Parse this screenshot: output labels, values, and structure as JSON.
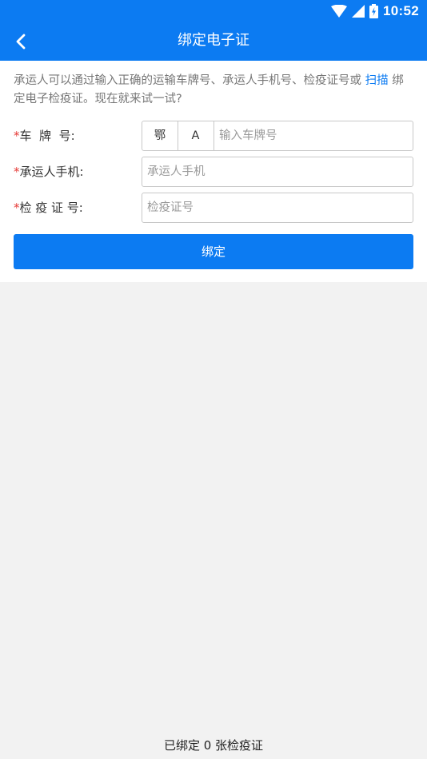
{
  "status_bar": {
    "time": "10:52"
  },
  "app_bar": {
    "title": "绑定电子证"
  },
  "intro": {
    "text_before": "承运人可以通过输入正确的运输车牌号、承运人手机号、检疫证号或 ",
    "link": "扫描",
    "text_after": " 绑定电子检疫证。现在就来试一试?"
  },
  "form": {
    "required_mark": "*",
    "plate": {
      "label": "车  牌  号:",
      "province": "鄂",
      "letter": "A",
      "placeholder": "输入车牌号"
    },
    "phone": {
      "label": "承运人手机:",
      "placeholder": "承运人手机"
    },
    "certificate": {
      "label": "检 疫 证 号:",
      "placeholder": "检疫证号"
    }
  },
  "bind_button": {
    "label": "绑定"
  },
  "footer": {
    "bound_count": "已绑定 0 张检疫证"
  }
}
